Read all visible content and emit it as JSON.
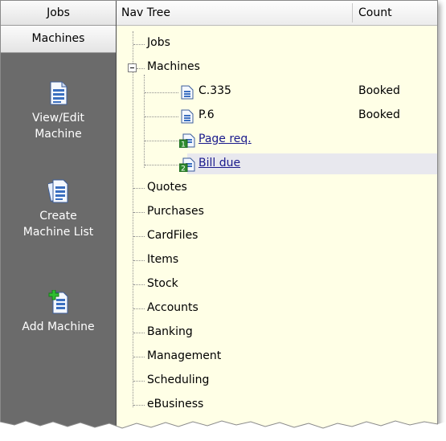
{
  "left_panel": {
    "tabs": [
      "Jobs",
      "Machines"
    ],
    "actions": [
      {
        "label_line1": "View/Edit",
        "label_line2": "Machine",
        "icon": "document-icon"
      },
      {
        "label_line1": "Create",
        "label_line2": "Machine List",
        "icon": "document-stack-icon"
      },
      {
        "label_line1": "Add Machine",
        "label_line2": "",
        "icon": "document-add-icon"
      }
    ]
  },
  "tree": {
    "columns": [
      "Nav Tree",
      "Count"
    ],
    "nodes": [
      {
        "label": "Jobs"
      },
      {
        "label": "Machines",
        "expanded": true,
        "children": [
          {
            "label": "C.335",
            "count": "Booked",
            "icon": "document-icon"
          },
          {
            "label": "P.6",
            "count": "Booked",
            "icon": "document-icon"
          },
          {
            "label": "Page req.",
            "icon": "report-1-icon",
            "link": true
          },
          {
            "label": "Bill due",
            "icon": "report-2-icon",
            "link": true,
            "selected": true
          }
        ]
      },
      {
        "label": "Quotes"
      },
      {
        "label": "Purchases"
      },
      {
        "label": "CardFiles"
      },
      {
        "label": "Items"
      },
      {
        "label": "Stock"
      },
      {
        "label": "Accounts"
      },
      {
        "label": "Banking"
      },
      {
        "label": "Management"
      },
      {
        "label": "Scheduling"
      },
      {
        "label": "eBusiness"
      }
    ]
  },
  "colors": {
    "panel_dark": "#6b6b6b",
    "tree_background": "#ffffe6",
    "selection": "#e8e8ee",
    "link": "#1a1a8c"
  }
}
